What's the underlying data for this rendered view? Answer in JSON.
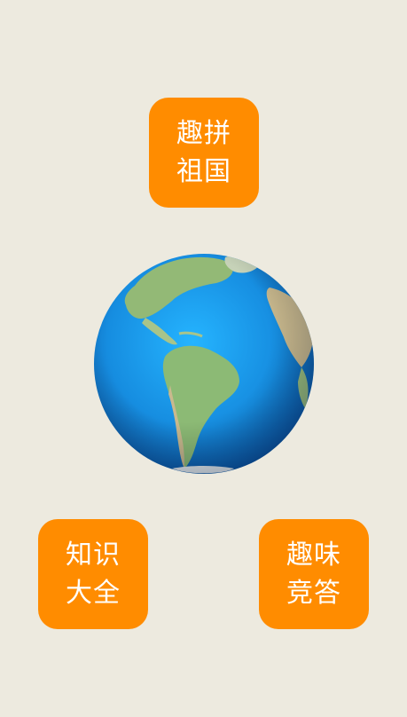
{
  "menu": {
    "puzzle_label": "趣拼\n祖国",
    "knowledge_label": "知识\n大全",
    "quiz_label": "趣味\n竞答"
  },
  "globe": {
    "icon": "globe-icon",
    "colors": {
      "ocean": "#1E8CE0",
      "ocean_deep": "#0A4E9A",
      "land": "#8FBF78",
      "land_dry": "#C9B98E"
    }
  },
  "colors": {
    "background": "#EDEADF",
    "tile": "#FF8C00",
    "tile_text": "#FFFFFF"
  }
}
